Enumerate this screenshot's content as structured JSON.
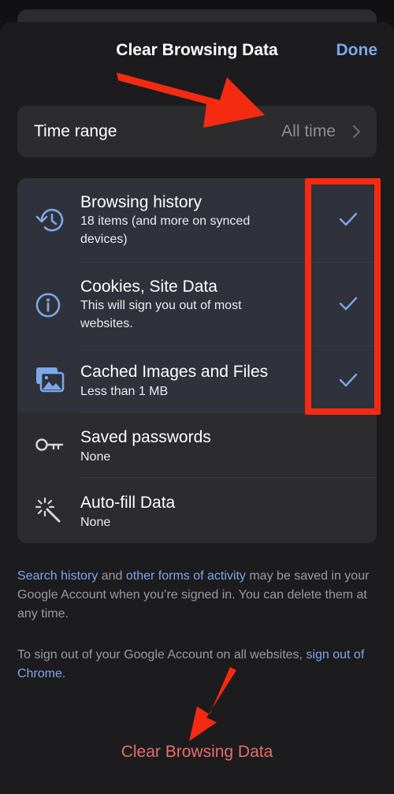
{
  "header": {
    "title": "Clear Browsing Data",
    "done_label": "Done"
  },
  "time_range": {
    "label": "Time range",
    "value": "All time"
  },
  "data_types": [
    {
      "title": "Browsing history",
      "subtitle": "18 items (and more on synced devices)",
      "checked": true,
      "icon": "history-icon"
    },
    {
      "title": "Cookies, Site Data",
      "subtitle": "This will sign you out of most websites.",
      "checked": true,
      "icon": "info-icon"
    },
    {
      "title": "Cached Images and Files",
      "subtitle": "Less than 1 MB",
      "checked": true,
      "icon": "images-icon"
    },
    {
      "title": "Saved passwords",
      "subtitle": "None",
      "checked": false,
      "icon": "key-icon"
    },
    {
      "title": "Auto-fill Data",
      "subtitle": "None",
      "checked": false,
      "icon": "magic-wand-icon"
    }
  ],
  "footnote1": {
    "link1": "Search history",
    "text1": " and ",
    "link2": "other forms of activity",
    "text2": " may be saved in your Google Account when you’re signed in. You can delete them at any time."
  },
  "footnote2": {
    "text": "To sign out of your Google Account on all websites, ",
    "link": "sign out of Chrome",
    "end": "."
  },
  "clear_button_label": "Clear Browsing Data",
  "colors": {
    "accent": "#7ea6ea",
    "destructive": "#e86c68",
    "annotation": "#f42b11"
  }
}
